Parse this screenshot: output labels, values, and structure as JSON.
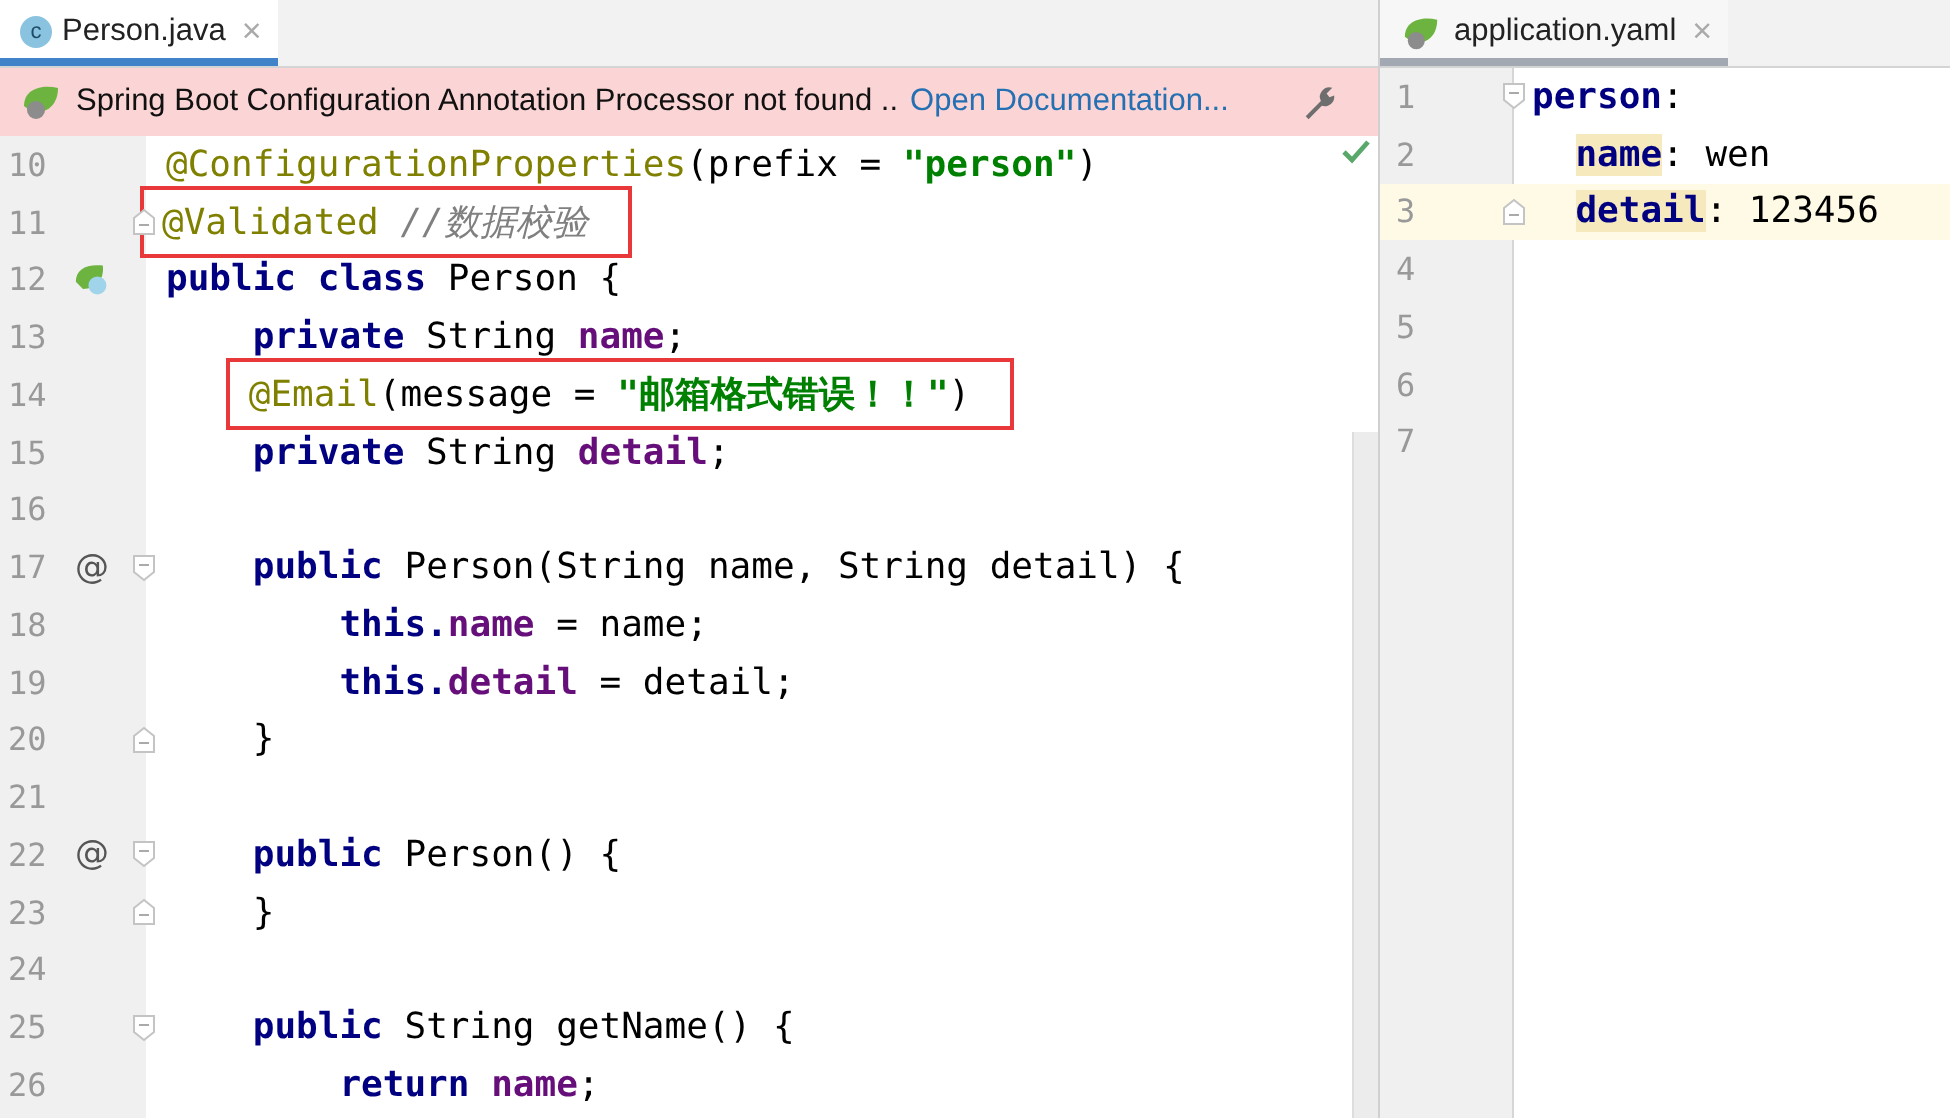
{
  "left_pane": {
    "tab": {
      "kind": "java",
      "icon_letter": "c",
      "label": "Person.java",
      "close": "×",
      "selected": true
    },
    "banner": {
      "text": "Spring Boot Configuration Annotation Processor not found ..",
      "link": "Open Documentation..."
    },
    "inspection_ok": true,
    "lines": [
      {
        "number": "10",
        "tokens": [
          {
            "kind": "annotation",
            "t": "@ConfigurationProperties"
          },
          {
            "kind": "plain",
            "t": "(prefix = "
          },
          {
            "kind": "string",
            "t": "\"person\""
          },
          {
            "kind": "plain",
            "t": ")"
          }
        ]
      },
      {
        "number": "11",
        "fold": {
          "kind": "end"
        },
        "boxed": true,
        "tokens": [
          {
            "kind": "annotation",
            "t": "@Validated"
          },
          {
            "kind": "comment",
            "t": " //数据校验"
          }
        ]
      },
      {
        "number": "12",
        "gutter_icon": {
          "kind": "bean"
        },
        "tokens": [
          {
            "kind": "keyword",
            "t": "public class"
          },
          {
            "kind": "plain",
            "t": " Person {"
          }
        ]
      },
      {
        "number": "13",
        "tokens": [
          {
            "kind": "keyword",
            "t": "    private"
          },
          {
            "kind": "plain",
            "t": " String "
          },
          {
            "kind": "field",
            "t": "name"
          },
          {
            "kind": "plain",
            "t": ";"
          }
        ]
      },
      {
        "number": "14",
        "boxed": true,
        "tokens": [
          {
            "kind": "annotation",
            "t": "    @Email"
          },
          {
            "kind": "plain",
            "t": "(message = "
          },
          {
            "kind": "string",
            "t": "\"邮箱格式错误！！\""
          },
          {
            "kind": "plain",
            "t": ")"
          }
        ]
      },
      {
        "number": "15",
        "tokens": [
          {
            "kind": "keyword",
            "t": "    private"
          },
          {
            "kind": "plain",
            "t": " String "
          },
          {
            "kind": "field",
            "t": "detail"
          },
          {
            "kind": "plain",
            "t": ";"
          }
        ]
      },
      {
        "number": "16"
      },
      {
        "number": "17",
        "gutter_text": "@",
        "fold": {
          "kind": "start"
        },
        "tokens": [
          {
            "kind": "keyword",
            "t": "    public"
          },
          {
            "kind": "plain",
            "t": " Person(String name, String detail) {"
          }
        ]
      },
      {
        "number": "18",
        "tokens": [
          {
            "kind": "keyword",
            "t": "        this."
          },
          {
            "kind": "field",
            "t": "name"
          },
          {
            "kind": "plain",
            "t": " = name;"
          }
        ]
      },
      {
        "number": "19",
        "tokens": [
          {
            "kind": "keyword",
            "t": "        this."
          },
          {
            "kind": "field",
            "t": "detail"
          },
          {
            "kind": "plain",
            "t": " = detail;"
          }
        ]
      },
      {
        "number": "20",
        "fold": {
          "kind": "end"
        },
        "tokens": [
          {
            "kind": "plain",
            "t": "    }"
          }
        ]
      },
      {
        "number": "21"
      },
      {
        "number": "22",
        "gutter_text": "@",
        "fold": {
          "kind": "start"
        },
        "tokens": [
          {
            "kind": "keyword",
            "t": "    public"
          },
          {
            "kind": "plain",
            "t": " Person() {"
          }
        ]
      },
      {
        "number": "23",
        "fold": {
          "kind": "end"
        },
        "tokens": [
          {
            "kind": "plain",
            "t": "    }"
          }
        ]
      },
      {
        "number": "24"
      },
      {
        "number": "25",
        "fold": {
          "kind": "start"
        },
        "tokens": [
          {
            "kind": "keyword",
            "t": "    public"
          },
          {
            "kind": "plain",
            "t": " String getName() {"
          }
        ]
      },
      {
        "number": "26",
        "tokens": [
          {
            "kind": "keyword",
            "t": "        return"
          },
          {
            "kind": "field",
            "t": " name"
          },
          {
            "kind": "plain",
            "t": ";"
          }
        ]
      }
    ]
  },
  "right_pane": {
    "tab": {
      "kind": "spring",
      "label": "application.yaml",
      "close": "×",
      "selected": false
    },
    "lines": [
      {
        "number": "1",
        "fold": {
          "kind": "start"
        },
        "current": false,
        "tokens": [
          {
            "kind": "key",
            "t": "person",
            "highlight": false
          },
          {
            "kind": "plain",
            "t": ":"
          }
        ]
      },
      {
        "number": "2",
        "current": false,
        "tokens": [
          {
            "kind": "key",
            "t": "  name",
            "highlight": true
          },
          {
            "kind": "plain",
            "t": ": wen"
          }
        ]
      },
      {
        "number": "3",
        "fold": {
          "kind": "end"
        },
        "current": true,
        "tokens": [
          {
            "kind": "key",
            "t": "  detail",
            "highlight": true
          },
          {
            "kind": "plain",
            "t": ": 123456"
          }
        ]
      },
      {
        "number": "4",
        "current": false
      },
      {
        "number": "5",
        "current": false
      },
      {
        "number": "6",
        "current": false
      },
      {
        "number": "7",
        "current": false
      }
    ]
  }
}
